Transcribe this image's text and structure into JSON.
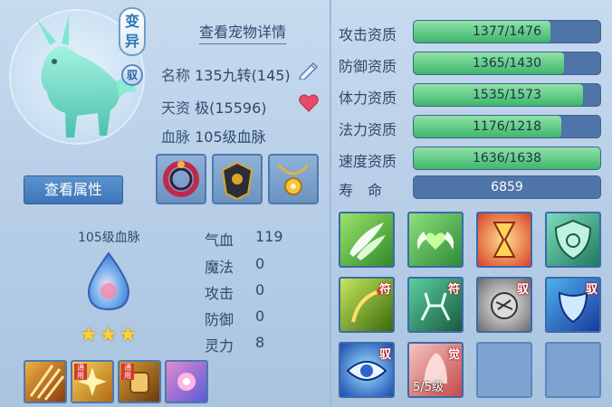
{
  "header": {
    "detail_link": "查看宠物详情",
    "mutation_badge": "变异",
    "tame_badge": "驭"
  },
  "info": {
    "name_label": "名称",
    "name_value": "135九转(145)",
    "talent_label": "天资",
    "talent_value": "极(15596)",
    "bloodline_label": "血脉",
    "bloodline_value": "105级血脉"
  },
  "buttons": {
    "view_attributes": "查看属性"
  },
  "bloodline_panel": {
    "title": "105级血脉",
    "stars": "★★★"
  },
  "base_stats": [
    {
      "label": "气血",
      "value": "119"
    },
    {
      "label": "魔法",
      "value": "0"
    },
    {
      "label": "攻击",
      "value": "0"
    },
    {
      "label": "防御",
      "value": "0"
    },
    {
      "label": "灵力",
      "value": "8"
    }
  ],
  "aptitudes": [
    {
      "label": "攻击资质",
      "text": "1377/1476",
      "fill": 0.733
    },
    {
      "label": "防御资质",
      "text": "1365/1430",
      "fill": 0.807
    },
    {
      "label": "体力资质",
      "text": "1535/1573",
      "fill": 0.906
    },
    {
      "label": "法力资质",
      "text": "1176/1218",
      "fill": 0.793
    },
    {
      "label": "速度资质",
      "text": "1636/1638",
      "fill": 0.998
    }
  ],
  "life": {
    "label": "寿　命",
    "value": "6859"
  },
  "small_skills": {
    "tag": "通用"
  },
  "skills": {
    "tag_fu": "符",
    "tag_yu": "驭",
    "tag_jue": "觉",
    "count": "5/5级"
  },
  "colors": {
    "bar_fill": "#3fb66b",
    "bar_track": "#4f74a7",
    "accent_blue": "#3c74b6"
  }
}
